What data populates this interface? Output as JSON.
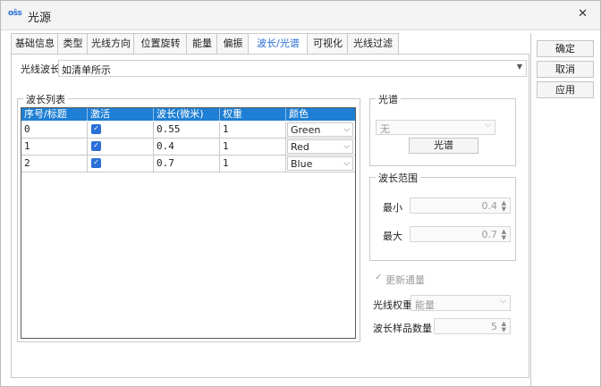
{
  "window": {
    "title": "光源",
    "app_icon": "oŝs"
  },
  "tabs": [
    {
      "label": "基础信息"
    },
    {
      "label": "类型"
    },
    {
      "label": "光线方向"
    },
    {
      "label": "位置旋转"
    },
    {
      "label": "能量"
    },
    {
      "label": "偏振"
    },
    {
      "label": "波长/光谱",
      "active": true
    },
    {
      "label": "可视化"
    },
    {
      "label": "光线过滤"
    }
  ],
  "wavelength": {
    "label": "光线波长",
    "value": "如清单所示"
  },
  "wl_table": {
    "title": "波长列表",
    "headers": [
      "序号/标题",
      "激活",
      "波长(微米)",
      "权重",
      "颜色"
    ],
    "rows": [
      {
        "index": "0",
        "active": true,
        "wavelength": "0.55",
        "weight": "1",
        "color": "Green"
      },
      {
        "index": "1",
        "active": true,
        "wavelength": "0.4",
        "weight": "1",
        "color": "Red"
      },
      {
        "index": "2",
        "active": true,
        "wavelength": "0.7",
        "weight": "1",
        "color": "Blue"
      }
    ]
  },
  "spectrum": {
    "title": "光谱",
    "select_value": "无",
    "button": "光谱"
  },
  "range": {
    "title": "波长范围",
    "min_label": "最小",
    "min_value": "0.4",
    "max_label": "最大",
    "max_value": "0.7"
  },
  "update_check": {
    "label": "更新通量"
  },
  "ray_weight": {
    "label": "光线权重",
    "value": "能量"
  },
  "sample_count": {
    "label": "波长样品数量",
    "value": "5"
  },
  "buttons": {
    "ok": "确定",
    "cancel": "取消",
    "apply": "应用"
  },
  "colors": {
    "accent": "#2a6fd6",
    "grid_header": "#1e7fd4"
  }
}
